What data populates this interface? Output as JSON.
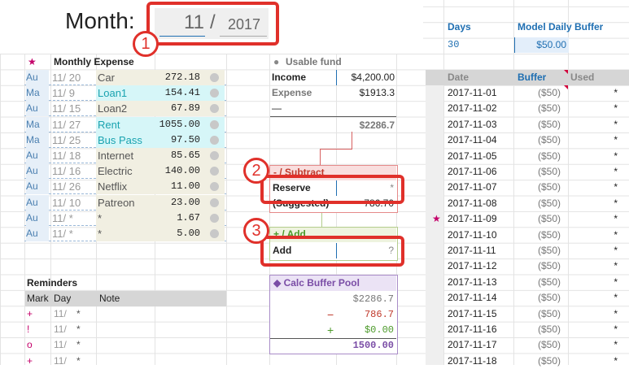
{
  "month_header": {
    "label": "Month:",
    "month": "11",
    "separator": "/",
    "year": "2017"
  },
  "expenses": {
    "star": "★",
    "title": "Monthly Expense",
    "rows": [
      {
        "who": "Au",
        "day": "11/ 20",
        "name": "Car",
        "amount": "272.18",
        "color": "#f1efe2"
      },
      {
        "who": "Ma",
        "day": "11/ 9",
        "name": "Loan1",
        "amount": "154.41",
        "color": "#d6f6f8"
      },
      {
        "who": "Au",
        "day": "11/ 15",
        "name": "Loan2",
        "amount": "67.89",
        "color": "#f1efe2"
      },
      {
        "who": "Ma",
        "day": "11/ 27",
        "name": "Rent",
        "amount": "1055.00",
        "color": "#d6f6f8"
      },
      {
        "who": "Ma",
        "day": "11/ 25",
        "name": "Bus Pass",
        "amount": "97.50",
        "color": "#d6f6f8"
      },
      {
        "who": "Au",
        "day": "11/ 18",
        "name": "Internet",
        "amount": "85.65",
        "color": "#f1efe2"
      },
      {
        "who": "Au",
        "day": "11/ 16",
        "name": "Electric",
        "amount": "140.00",
        "color": "#f1efe2"
      },
      {
        "who": "Au",
        "day": "11/ 26",
        "name": "Netflix",
        "amount": "11.00",
        "color": "#f1efe2"
      },
      {
        "who": "Au",
        "day": "11/ 10",
        "name": "Patreon",
        "amount": "23.00",
        "color": "#f1efe2"
      },
      {
        "who": "Au",
        "day": "11/ *",
        "name": "*",
        "amount": "1.67",
        "color": "#f1efe2"
      },
      {
        "who": "Au",
        "day": "11/ *",
        "name": "*",
        "amount": "5.00",
        "color": "#f1efe2"
      }
    ]
  },
  "reminders": {
    "title": "Reminders",
    "headers": [
      "Mark",
      "Day",
      "Note"
    ],
    "rows": [
      {
        "mark": "+",
        "day": "11/",
        "note": "*"
      },
      {
        "mark": "!",
        "day": "11/",
        "note": "*"
      },
      {
        "mark": "o",
        "day": "11/",
        "note": "*"
      },
      {
        "mark": "+",
        "day": "11/",
        "note": "*"
      }
    ]
  },
  "fund": {
    "title": "Usable fund",
    "income_label": "Income",
    "income_value": "$4,200.00",
    "expense_label": "Expense",
    "expense_value": "$1913.3",
    "minus": "—",
    "total": "$2286.7"
  },
  "subtract": {
    "header": "- / Subtract",
    "reserve_label": "Reserve",
    "reserve_value": "*",
    "suggested_label": "(Suggested)",
    "suggested_value": "786.70"
  },
  "add_box": {
    "header": "+ / Add",
    "label": "Add",
    "value": "?"
  },
  "calc": {
    "title": "◆ Calc Buffer Pool",
    "value1": "$2286.7",
    "minus_sign": "−",
    "value2": "786.7",
    "plus_sign": "+",
    "value3": "$0.00",
    "result": "1500.00"
  },
  "buffer_model": {
    "days_label": "Days",
    "days_value": "30",
    "model_label": "Model Daily Buffer",
    "model_value": "$50.00",
    "headers": [
      "Date",
      "Buffer",
      "Used"
    ],
    "rows": [
      {
        "date": "2017-11-01",
        "buffer": "($50)",
        "used": "*"
      },
      {
        "date": "2017-11-02",
        "buffer": "($50)",
        "used": "*"
      },
      {
        "date": "2017-11-03",
        "buffer": "($50)",
        "used": "*"
      },
      {
        "date": "2017-11-04",
        "buffer": "($50)",
        "used": "*"
      },
      {
        "date": "2017-11-05",
        "buffer": "($50)",
        "used": "*"
      },
      {
        "date": "2017-11-06",
        "buffer": "($50)",
        "used": "*"
      },
      {
        "date": "2017-11-07",
        "buffer": "($50)",
        "used": "*"
      },
      {
        "date": "2017-11-08",
        "buffer": "($50)",
        "used": "*"
      },
      {
        "date": "2017-11-09",
        "buffer": "($50)",
        "used": "*",
        "star": "★"
      },
      {
        "date": "2017-11-10",
        "buffer": "($50)",
        "used": "*"
      },
      {
        "date": "2017-11-11",
        "buffer": "($50)",
        "used": "*"
      },
      {
        "date": "2017-11-12",
        "buffer": "($50)",
        "used": "*"
      },
      {
        "date": "2017-11-13",
        "buffer": "($50)",
        "used": "*"
      },
      {
        "date": "2017-11-14",
        "buffer": "($50)",
        "used": "*"
      },
      {
        "date": "2017-11-15",
        "buffer": "($50)",
        "used": "*"
      },
      {
        "date": "2017-11-16",
        "buffer": "($50)",
        "used": "*"
      },
      {
        "date": "2017-11-17",
        "buffer": "($50)",
        "used": "*"
      },
      {
        "date": "2017-11-18",
        "buffer": "($50)",
        "used": "*"
      }
    ]
  },
  "annotations": [
    "1",
    "2",
    "3"
  ],
  "colors": {
    "accent_blue": "#1f6fb2",
    "red": "#e0302a",
    "purple": "#7a4da6",
    "green": "#4c9a2a",
    "magenta": "#c4006a"
  }
}
